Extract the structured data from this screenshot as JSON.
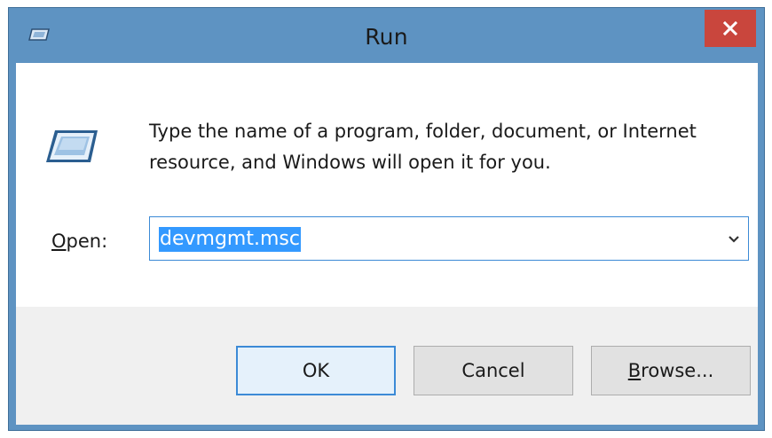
{
  "window": {
    "title": "Run",
    "close_icon": "close-icon",
    "title_icon": "run-icon"
  },
  "dialog": {
    "description": "Type the name of a program, folder, document, or Internet resource, and Windows will open it for you.",
    "open_label_mnemonic": "O",
    "open_label_rest": "pen:",
    "open_value": "devmgmt.msc",
    "dropdown_icon": "chevron-down-icon"
  },
  "buttons": {
    "ok_label": "OK",
    "cancel_label": "Cancel",
    "browse_mnemonic": "B",
    "browse_rest": "rowse..."
  },
  "colors": {
    "titlebar": "#5e93c2",
    "close_button": "#c9463d",
    "selection": "#3399ff",
    "focus_border": "#3c8ad6"
  }
}
